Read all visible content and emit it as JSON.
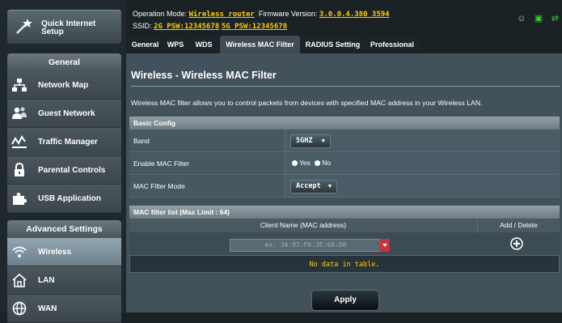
{
  "quick_setup": {
    "label": "Quick Internet Setup"
  },
  "sidebar": {
    "general_header": "General",
    "general_items": [
      {
        "label": "Network Map",
        "icon": "network-map-icon"
      },
      {
        "label": "Guest Network",
        "icon": "guest-network-icon"
      },
      {
        "label": "Traffic Manager",
        "icon": "traffic-manager-icon"
      },
      {
        "label": "Parental Controls",
        "icon": "parental-controls-icon"
      },
      {
        "label": "USB Application",
        "icon": "usb-application-icon"
      }
    ],
    "advanced_header": "Advanced Settings",
    "advanced_items": [
      {
        "label": "Wireless",
        "icon": "wireless-icon",
        "active": true
      },
      {
        "label": "LAN",
        "icon": "lan-icon"
      },
      {
        "label": "WAN",
        "icon": "wan-icon"
      }
    ]
  },
  "header": {
    "operation_mode_label": "Operation Mode:",
    "operation_mode_value": "Wireless router",
    "firmware_label": "Firmware Version:",
    "firmware_value": "3.0.0.4.380_3594",
    "ssid_label": "SSID:",
    "ssid_2g": "2G_PSW:12345678",
    "ssid_5g": "5G_PSW:12345678"
  },
  "tabs": [
    "General",
    "WPS",
    "WDS",
    "Wireless MAC Filter",
    "RADIUS Setting",
    "Professional"
  ],
  "page": {
    "title": "Wireless - Wireless MAC Filter",
    "description": "Wireless MAC filter allows you to control packets from devices with specified MAC address in your Wireless LAN."
  },
  "basic_config": {
    "header": "Basic Config",
    "band_label": "Band",
    "band_value": "5GHZ",
    "enable_label": "Enable MAC Filter",
    "yes_label": "Yes",
    "no_label": "No",
    "mode_label": "MAC Filter Mode",
    "mode_value": "Accept"
  },
  "mac_list": {
    "header": "MAC filter list (Max Limit : 64)",
    "col_client": "Client Name (MAC address)",
    "col_action": "Add / Delete",
    "input_placeholder": "ex: 34:97:F6:3E:68:D0",
    "empty_text": "No data in table."
  },
  "apply_label": "Apply",
  "colors": {
    "accent_yellow": "#ffcc00",
    "active_menu": "#93a7b2",
    "dropdown_red": "#c8323a"
  }
}
